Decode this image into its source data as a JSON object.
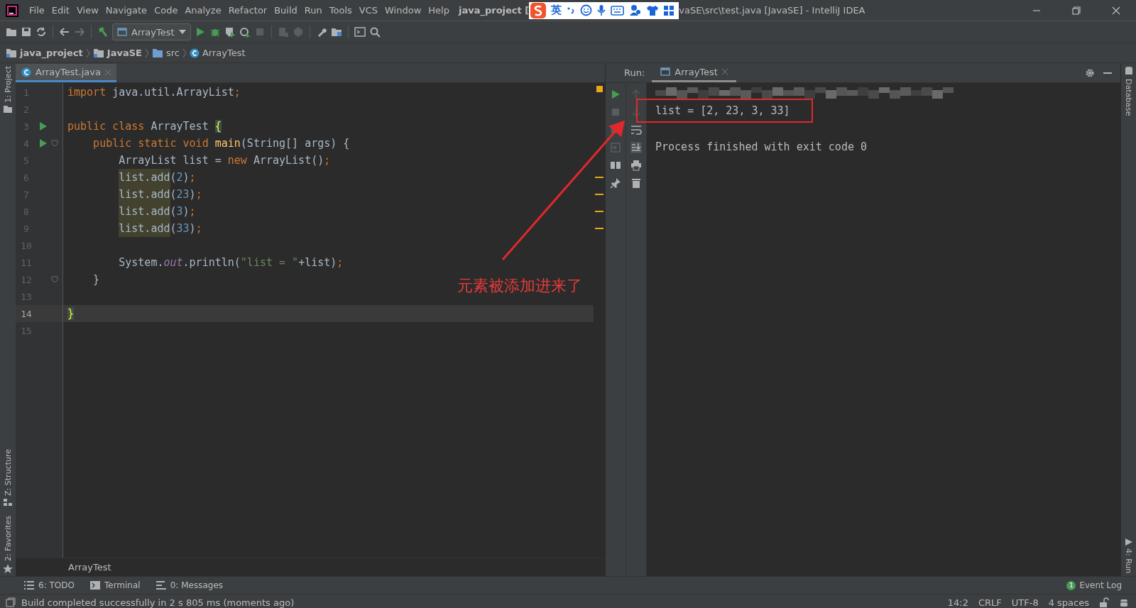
{
  "window": {
    "title_left": "java_project [",
    "title_right": "vaSE\\src\\test.java [JavaSE] - IntelliJ IDEA"
  },
  "ime_bar": {
    "label": "英"
  },
  "menu": [
    "File",
    "Edit",
    "View",
    "Navigate",
    "Code",
    "Analyze",
    "Refactor",
    "Build",
    "Run",
    "Tools",
    "VCS",
    "Window",
    "Help"
  ],
  "toolbar": {
    "run_config": "ArrayTest"
  },
  "breadcrumbs": [
    {
      "label": "java_project",
      "kind": "module"
    },
    {
      "label": "JavaSE",
      "kind": "module"
    },
    {
      "label": "src",
      "kind": "folder"
    },
    {
      "label": "ArrayTest",
      "kind": "class"
    }
  ],
  "left_stripe": {
    "top": [
      "1: Project"
    ],
    "bottom": [
      "Z: Structure",
      "2: Favorites"
    ]
  },
  "right_stripe": {
    "top": [
      "Database"
    ],
    "bottom": [
      "4: Run"
    ]
  },
  "editor": {
    "tabs": [
      {
        "label": "ArrayTest.java",
        "selected": true
      }
    ],
    "lines": [
      {
        "n": "1",
        "run": false,
        "fold": false,
        "current": false,
        "tokens": [
          {
            "t": "import ",
            "kind": "keyword"
          },
          {
            "t": "java.util.ArrayList",
            "kind": "plain"
          },
          {
            "t": ";",
            "kind": "keyword"
          }
        ]
      },
      {
        "n": "2",
        "run": false,
        "fold": false,
        "current": false
      },
      {
        "n": "3",
        "run": true,
        "fold": false,
        "current": false,
        "tokens": [
          {
            "t": "public class ",
            "kind": "keyword"
          },
          {
            "t": "ArrayTest ",
            "kind": "plain"
          },
          {
            "t": "{",
            "kind": "brace"
          }
        ]
      },
      {
        "n": "4",
        "run": true,
        "fold": true,
        "current": false,
        "tokens": [
          {
            "t": "    public static void ",
            "kind": "keyword"
          },
          {
            "t": "main",
            "kind": "method"
          },
          {
            "t": "(String[] args) {",
            "kind": "plain"
          }
        ]
      },
      {
        "n": "5",
        "run": false,
        "fold": false,
        "current": false,
        "tokens": [
          {
            "t": "        ArrayList list = ",
            "kind": "plain"
          },
          {
            "t": "new ",
            "kind": "keyword"
          },
          {
            "t": "ArrayList()",
            "kind": "plain"
          },
          {
            "t": ";",
            "kind": "keyword"
          }
        ]
      },
      {
        "n": "6",
        "run": false,
        "fold": false,
        "current": false,
        "tokens": [
          {
            "t": "        list.add",
            "kind": "usage"
          },
          {
            "t": "(",
            "kind": "plain"
          },
          {
            "t": "2",
            "kind": "number"
          },
          {
            "t": ")",
            "kind": "plain"
          },
          {
            "t": ";",
            "kind": "keyword"
          }
        ]
      },
      {
        "n": "7",
        "run": false,
        "fold": false,
        "current": false,
        "tokens": [
          {
            "t": "        list.add",
            "kind": "usage"
          },
          {
            "t": "(",
            "kind": "plain"
          },
          {
            "t": "23",
            "kind": "number"
          },
          {
            "t": ")",
            "kind": "plain"
          },
          {
            "t": ";",
            "kind": "keyword"
          }
        ]
      },
      {
        "n": "8",
        "run": false,
        "fold": false,
        "current": false,
        "tokens": [
          {
            "t": "        list.add",
            "kind": "usage"
          },
          {
            "t": "(",
            "kind": "plain"
          },
          {
            "t": "3",
            "kind": "number"
          },
          {
            "t": ")",
            "kind": "plain"
          },
          {
            "t": ";",
            "kind": "keyword"
          }
        ]
      },
      {
        "n": "9",
        "run": false,
        "fold": false,
        "current": false,
        "tokens": [
          {
            "t": "        list.add",
            "kind": "usage"
          },
          {
            "t": "(",
            "kind": "plain"
          },
          {
            "t": "33",
            "kind": "number"
          },
          {
            "t": ")",
            "kind": "plain"
          },
          {
            "t": ";",
            "kind": "keyword"
          }
        ]
      },
      {
        "n": "10",
        "run": false,
        "fold": false,
        "current": false
      },
      {
        "n": "11",
        "run": false,
        "fold": false,
        "current": false,
        "tokens": [
          {
            "t": "        System.",
            "kind": "plain"
          },
          {
            "t": "out",
            "kind": "static"
          },
          {
            "t": ".println(",
            "kind": "plain"
          },
          {
            "t": "\"list = \"",
            "kind": "string"
          },
          {
            "t": "+list)",
            "kind": "plain"
          },
          {
            "t": ";",
            "kind": "keyword"
          }
        ]
      },
      {
        "n": "12",
        "run": false,
        "fold": true,
        "current": false,
        "tokens": [
          {
            "t": "    }",
            "kind": "plain"
          }
        ]
      },
      {
        "n": "13",
        "run": false,
        "fold": false,
        "current": false
      },
      {
        "n": "14",
        "run": false,
        "fold": false,
        "current": true,
        "tokens": [
          {
            "t": "}",
            "kind": "brace"
          }
        ]
      },
      {
        "n": "15",
        "run": false,
        "fold": false,
        "current": false
      }
    ],
    "breadcrumb": "ArrayTest"
  },
  "run_panel": {
    "title": "Run:",
    "tabs": [
      {
        "label": "ArrayTest",
        "selected": true
      }
    ],
    "output": [
      {
        "text": "list = [2, 23, 3, 33]",
        "framed": true
      },
      {
        "text": "Process finished with exit code 0",
        "framed": false
      }
    ]
  },
  "annotation": {
    "text": "元素被添加进来了"
  },
  "tool_buttons": [
    {
      "label": "6: TODO",
      "kind": "todo"
    },
    {
      "label": "Terminal",
      "kind": "terminal"
    },
    {
      "label": "0: Messages",
      "kind": "messages"
    }
  ],
  "event_log": {
    "label": "Event Log",
    "badge": "1"
  },
  "status_bar": {
    "message": "Build completed successfully in 2 s 805 ms (moments ago)",
    "position": "14:2",
    "line_sep": "CRLF",
    "encoding": "UTF-8",
    "indent": "4 spaces"
  }
}
